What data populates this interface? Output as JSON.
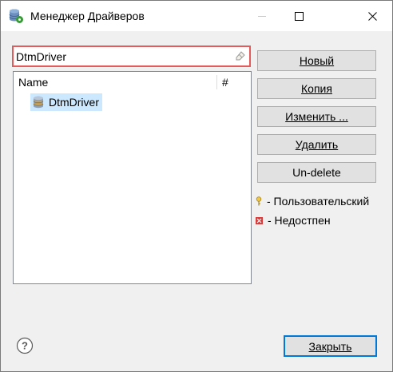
{
  "window": {
    "title": "Менеджер Драйверов"
  },
  "search": {
    "value": "DtmDriver",
    "placeholder": ""
  },
  "tree": {
    "columns": [
      "Name",
      "#"
    ],
    "items": [
      {
        "label": "DtmDriver",
        "count": ""
      }
    ]
  },
  "actions": {
    "new_label": "Новый",
    "copy_label": "Копия",
    "edit_label": "Изменить ...",
    "delete_label": "Удалить",
    "undelete_label": "Un-delete"
  },
  "legend": {
    "user_defined": "- Пользовательский",
    "unavailable": "- Недостпен"
  },
  "footer": {
    "close_label": "Закрыть"
  },
  "colors": {
    "selection": "#cce8ff",
    "search_border": "#e35b5b",
    "default_button_border": "#0078d7"
  },
  "icons": {
    "app": "database-driver-icon",
    "clear": "eraser-icon",
    "driver": "database-icon",
    "user_defined": "key-icon",
    "unavailable": "error-x-icon",
    "help": "help-icon"
  }
}
